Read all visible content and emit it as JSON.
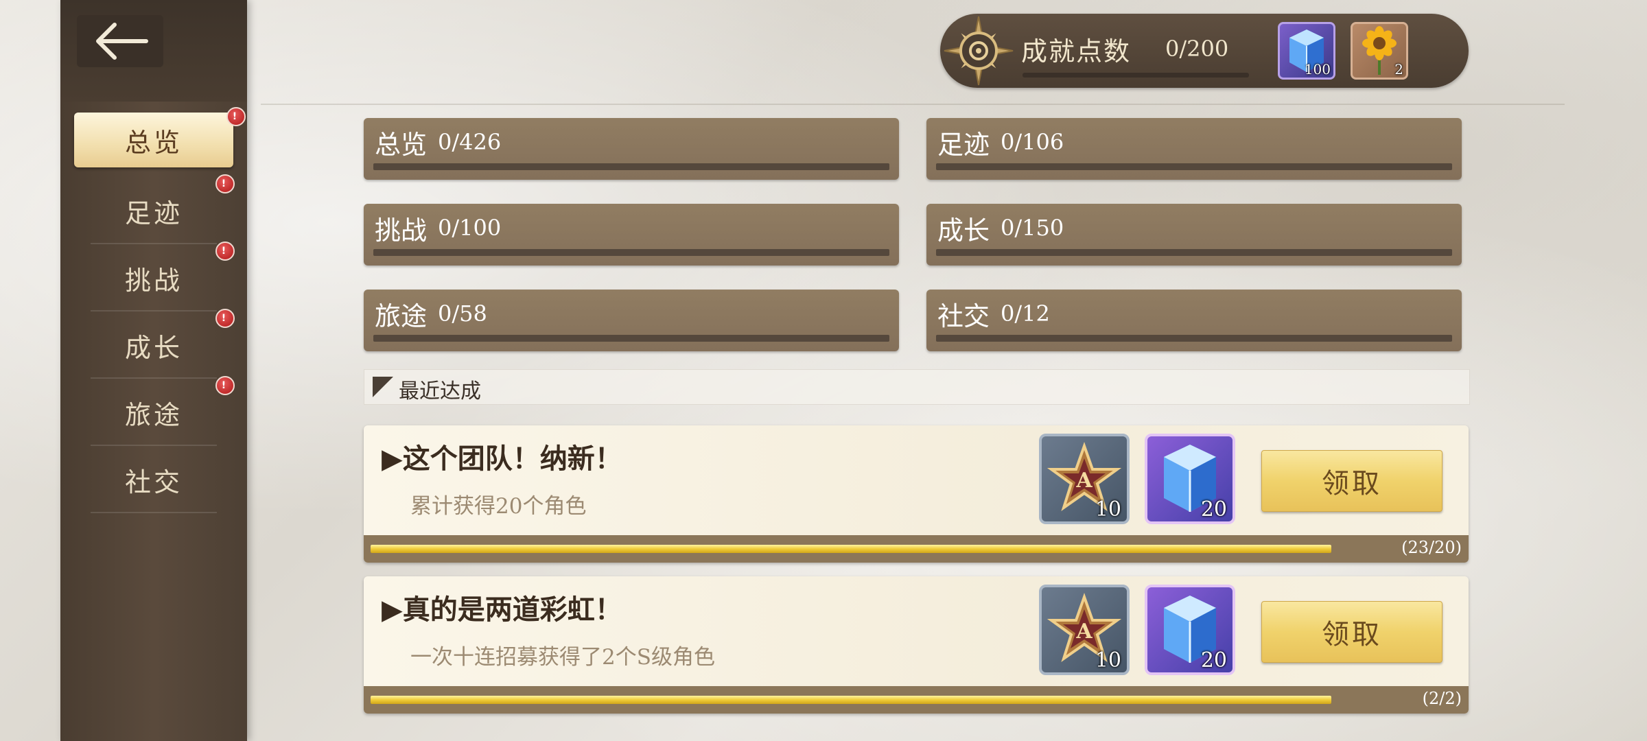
{
  "header": {
    "points_label": "成就点数",
    "points_value": "0/200",
    "points_progress": 0,
    "rewards": [
      {
        "icon": "blue-crystal-icon",
        "count": "100"
      },
      {
        "icon": "sunflower-icon",
        "count": "2"
      }
    ]
  },
  "sidebar": {
    "items": [
      {
        "label": "总览",
        "badge": "!",
        "active": true
      },
      {
        "label": "足迹",
        "badge": "!"
      },
      {
        "label": "挑战",
        "badge": "!"
      },
      {
        "label": "成长",
        "badge": "!"
      },
      {
        "label": "旅途",
        "badge": "!"
      },
      {
        "label": "社交"
      }
    ]
  },
  "categories": [
    {
      "name": "总览",
      "count": "0/426"
    },
    {
      "name": "足迹",
      "count": "0/106"
    },
    {
      "name": "挑战",
      "count": "0/100"
    },
    {
      "name": "成长",
      "count": "0/150"
    },
    {
      "name": "旅途",
      "count": "0/58"
    },
    {
      "name": "社交",
      "count": "0/12"
    }
  ],
  "recent": {
    "title": "最近达成",
    "achievements": [
      {
        "title": "▶这个团队！纳新！",
        "desc": "累计获得20个角色",
        "rewards": [
          {
            "icon": "a-rank-star-medal-icon",
            "count": "10"
          },
          {
            "icon": "blue-crystal-icon",
            "count": "20"
          }
        ],
        "claim_label": "领取",
        "progress_text": "(23/20)",
        "progress_fraction": 1.0
      },
      {
        "title": "▶真的是两道彩虹！",
        "desc": "一次十连招募获得了2个S级角色",
        "rewards": [
          {
            "icon": "a-rank-star-medal-icon",
            "count": "10"
          },
          {
            "icon": "blue-crystal-icon",
            "count": "20"
          }
        ],
        "claim_label": "领取",
        "progress_text": "(2/2)",
        "progress_fraction": 1.0
      }
    ]
  },
  "colors": {
    "sidebar_bg": "#4d4034",
    "category_bg": "#8a765e",
    "claim_button": "#f0d26b",
    "badge_red": "#c62020"
  }
}
